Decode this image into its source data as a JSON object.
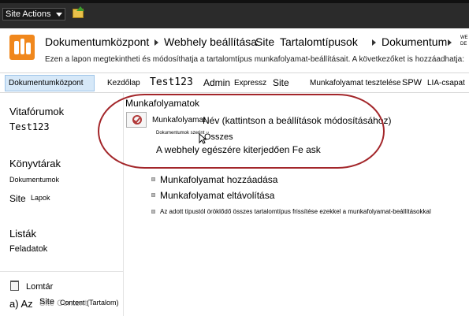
{
  "topbar": {
    "site_actions": "Site Actions"
  },
  "breadcrumb": {
    "items": [
      "Dokumentumközpont",
      "Webhely beállítása",
      "Site",
      "Tartalomtípusok",
      "Dokumentum"
    ],
    "overflow": "WE\nDE"
  },
  "description": "Ezen a lapon megtekintheti és módosíthatja a tartalomtípus munkafolyamat-beállításait. A következőket is hozzáadhatja:",
  "topnav": {
    "active": "Dokumentumközpont",
    "items": [
      "Kezdőlap",
      "Test123",
      "Admin",
      "Expressz",
      "Site",
      "Munkafolyamat tesztelése",
      "SPW",
      "LIA-csapat"
    ]
  },
  "leftnav": {
    "discussions_heading": "Vitafórumok",
    "discussions_item": "Test123",
    "libraries_heading": "Könyvtárak",
    "libraries_item1": "Dokumentumok",
    "libraries_site": "Site",
    "libraries_pages": "Lapok",
    "lists_heading": "Listák",
    "lists_item": "Feladatok",
    "trash": "Lomtár",
    "content_a": "a) Az",
    "content_site": "Site",
    "content_label": "Content (Tartalom)",
    "content_overlap": "Site Content"
  },
  "main": {
    "section_title": "Munkafolyamatok",
    "column_workflow": "Munkafolyamat",
    "column_name": "Név (kattintson a beállítások módosításához)",
    "row_small": "Dokumentumok szerint",
    "row_all": "Összes",
    "row_webhely": "A webhely egészére kiterjedően Fe ask",
    "links": [
      "Munkafolyamat hozzáadása",
      "Munkafolyamat eltávolítása",
      "Az adott típustól öröklődő összes tartalomtípus frissítése ezekkel a munkafolyamat-beállításokkal"
    ]
  },
  "colors": {
    "topbar": "#2b2b2b",
    "accent_nav": "#d6e8f8",
    "logo": "#f0871c",
    "highlight_oval": "#a3262a"
  },
  "icons": [
    "site-actions-caret-icon",
    "navigate-up-icon",
    "site-logo-icon",
    "breadcrumb-separator-icon",
    "workflow-icon",
    "bullet-icon",
    "recycle-bin-icon",
    "mouse-cursor-icon"
  ]
}
